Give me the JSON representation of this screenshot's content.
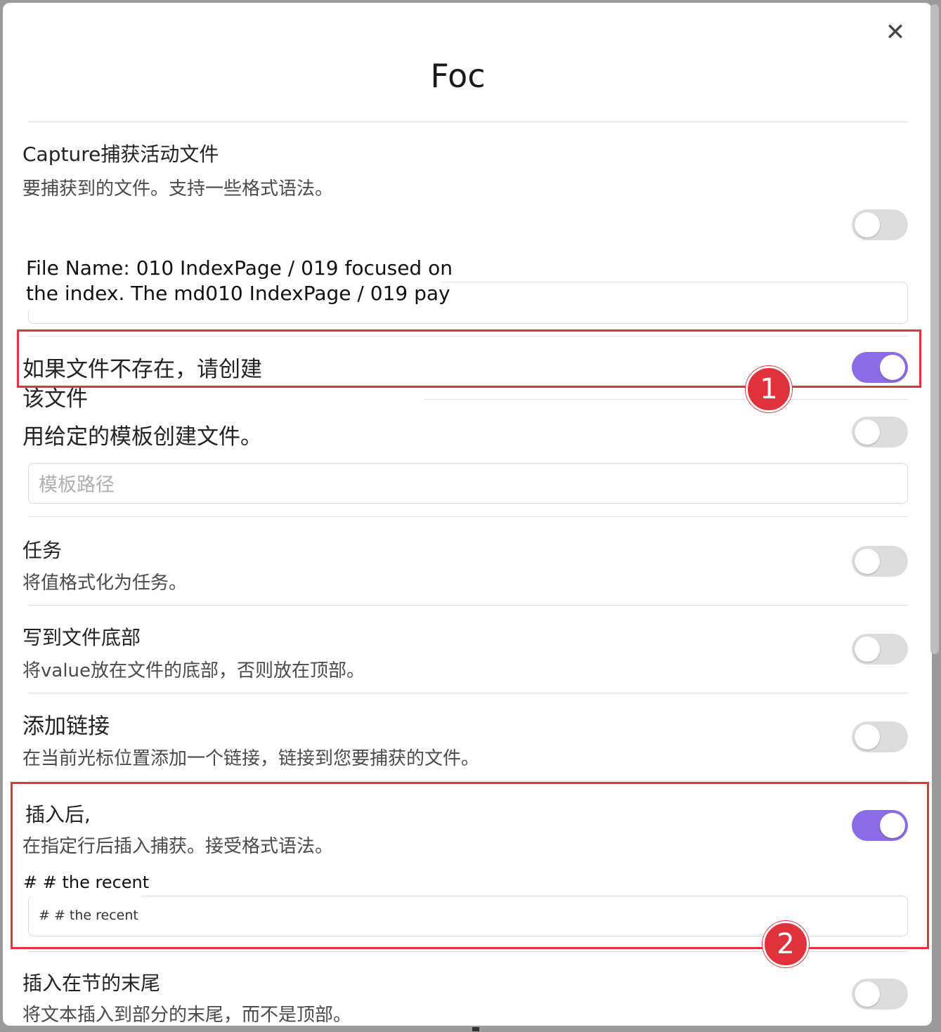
{
  "modal": {
    "title": "Foc",
    "close_icon": "close-icon"
  },
  "capture": {
    "label": "Capture捕获活动文件",
    "description": "要捕获到的文件。支持一些格式语法。",
    "toggle_on": false,
    "tooltip_line1": "File Name: 010 IndexPage / 019 focused on",
    "tooltip_line2": "the index. The md010 IndexPage / 019 pay"
  },
  "create_if_missing": {
    "label_line1": "如果文件不存在，请创建",
    "label_line2": "该文件",
    "toggle_on": true
  },
  "template": {
    "label": "用给定的模板创建文件。",
    "toggle_on": false,
    "placeholder": "模板路径"
  },
  "task": {
    "label": "任务",
    "description": "将值格式化为任务。",
    "toggle_on": false
  },
  "write_bottom": {
    "label": "写到文件底部",
    "description": "将value放在文件的底部，否则放在顶部。",
    "toggle_on": false
  },
  "add_link": {
    "label": "添加链接",
    "description": "在当前光标位置添加一个链接，链接到您要捕获的文件。",
    "toggle_on": false
  },
  "insert_after": {
    "label": "插入后,",
    "description": "在指定行后插入捕获。接受格式语法。",
    "toggle_on": true,
    "tooltip": "# # the recent",
    "value": "# # the recent"
  },
  "insert_end": {
    "label": "插入在节的末尾",
    "description": "将文本插入到部分的末尾，而不是顶部。",
    "toggle_on": false
  },
  "annotations": {
    "badge1": "1",
    "badge2": "2",
    "accent_color": "#8c6ce6",
    "highlight_color": "#e5323b"
  }
}
